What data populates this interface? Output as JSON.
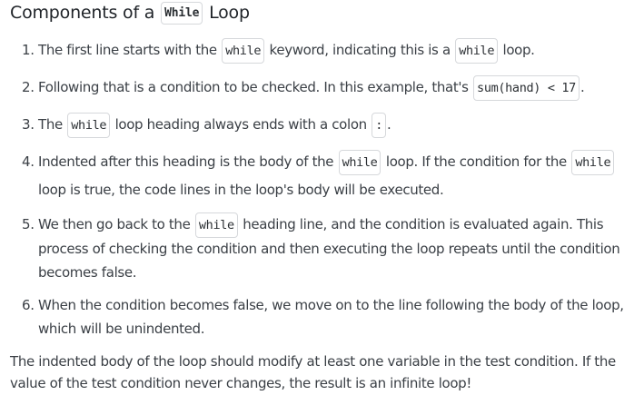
{
  "heading": {
    "prefix": "Components of a",
    "code": "While",
    "suffix": "Loop"
  },
  "steps": [
    {
      "number": "1.",
      "parts": [
        "The first line starts with the ",
        "while",
        " keyword, indicating this is a ",
        "while",
        " loop."
      ]
    },
    {
      "number": "2.",
      "parts": [
        "Following that is a condition to be checked. In this example, that's ",
        "sum(hand) < 17",
        "."
      ]
    },
    {
      "number": "3.",
      "parts": [
        "The ",
        "while",
        " loop heading always ends with a colon ",
        ":",
        "."
      ]
    },
    {
      "number": "4.",
      "parts": [
        "Indented after this heading is the body of the ",
        "while",
        " loop. If the condition for the ",
        "while",
        " loop is true, the code lines in the loop's body will be executed."
      ]
    },
    {
      "number": "5.",
      "parts": [
        "We then go back to the ",
        "while",
        " heading line, and the condition is evaluated again. This process of checking the condition and then executing the loop repeats until the condition becomes false."
      ]
    },
    {
      "number": "6.",
      "parts": [
        "When the condition becomes false, we move on to the line following the body of the loop, which will be unindented."
      ]
    }
  ],
  "summary": "The indented body of the loop should modify at least one variable in the test condition. If the value of the test condition never changes, the result is an infinite loop!"
}
